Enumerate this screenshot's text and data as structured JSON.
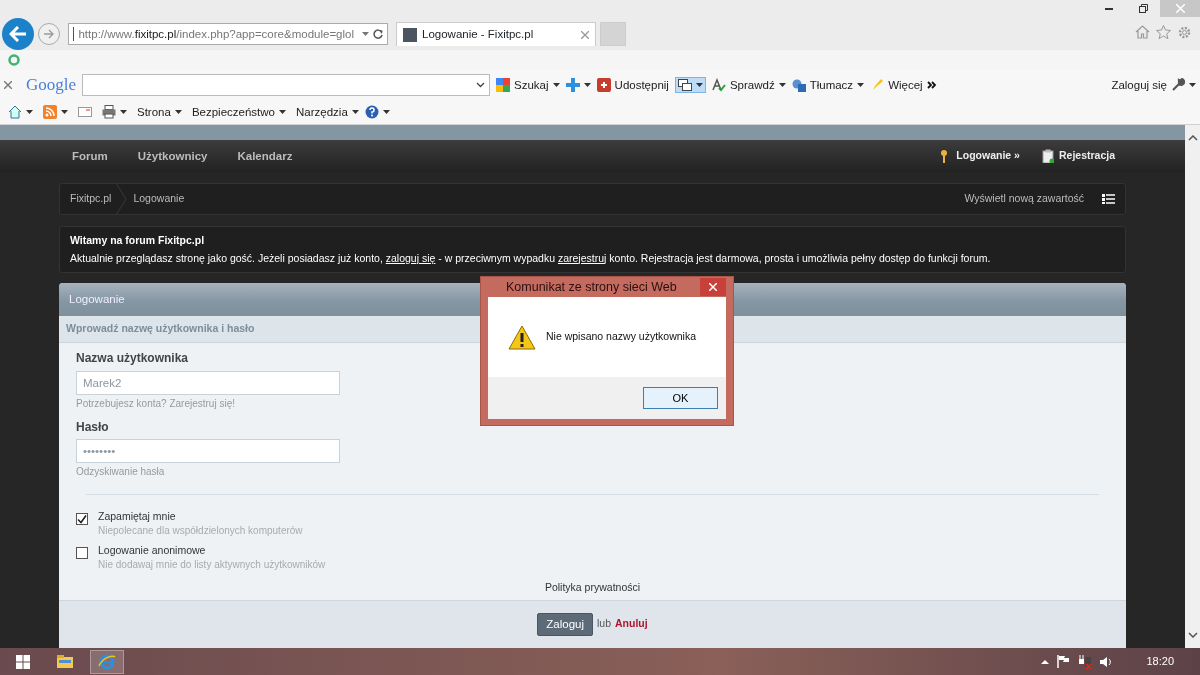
{
  "browser": {
    "address_prefix": "http://www.",
    "address_domain": "fixitpc.pl",
    "address_rest": "/index.php?app=core&module=glol",
    "tabs": [
      {
        "title": "Logowanie - Fixitpc.pl",
        "selected": true
      }
    ]
  },
  "google_toolbar": {
    "logo": "Google",
    "items": [
      {
        "label": "Szukaj",
        "dropdown": true
      },
      {
        "label": "Udostępnij",
        "dropdown": false
      },
      {
        "label": "Sprawdź",
        "dropdown": true
      },
      {
        "label": "Tłumacz",
        "dropdown": true
      },
      {
        "label": "Więcej",
        "dropdown": false
      }
    ],
    "sign_in": "Zaloguj się"
  },
  "command_bar": [
    "Strona",
    "Bezpieczeństwo",
    "Narzędzia"
  ],
  "forum": {
    "nav": [
      "Forum",
      "Użytkownicy",
      "Kalendarz"
    ],
    "user_links": [
      "Logowanie »",
      "Rejestracja"
    ],
    "breadcrumb": [
      "Fixitpc.pl",
      "Logowanie"
    ],
    "new_content": "Wyświetl nową zawartość",
    "welcome": {
      "title": "Witamy na forum Fixitpc.pl",
      "segments": [
        {
          "text": "Aktualnie przeglądasz stronę jako gość. Jeżeli posiadasz już konto, ",
          "link": false
        },
        {
          "text": "zaloguj się",
          "link": true
        },
        {
          "text": " - w przeciwnym wypadku ",
          "link": false
        },
        {
          "text": "zarejestruj",
          "link": true
        },
        {
          "text": " konto. Rejestracja jest darmowa, prosta i umożliwia pełny dostęp do funkcji forum.",
          "link": false
        }
      ]
    },
    "login": {
      "title": "Logowanie",
      "subtitle": "Wprowadź nazwę użytkownika i hasło",
      "fields": [
        {
          "label": "Nazwa użytkownika",
          "value": "Marek2",
          "hint": "Potrzebujesz konta?",
          "link": "Zarejestruj się!"
        },
        {
          "label": "Hasło",
          "value": "••••••••",
          "link": "Odzyskiwanie hasła"
        }
      ],
      "options": [
        {
          "label": "Zapamiętaj mnie",
          "note": "Niepolecane dla współdzielonych komputerów",
          "checked": true
        },
        {
          "label": "Logowanie anonimowe",
          "note": "Nie dodawaj mnie do listy aktywnych użytkowników",
          "checked": false
        }
      ],
      "privacy": "Polityka prywatności",
      "submit": "Zaloguj",
      "or": "lub",
      "cancel": "Anuluj"
    }
  },
  "dialog": {
    "title": "Komunikat ze strony sieci Web",
    "message": "Nie wpisano nazwy użytkownika",
    "button": "OK"
  },
  "taskbar": {
    "clock": "18:20"
  }
}
